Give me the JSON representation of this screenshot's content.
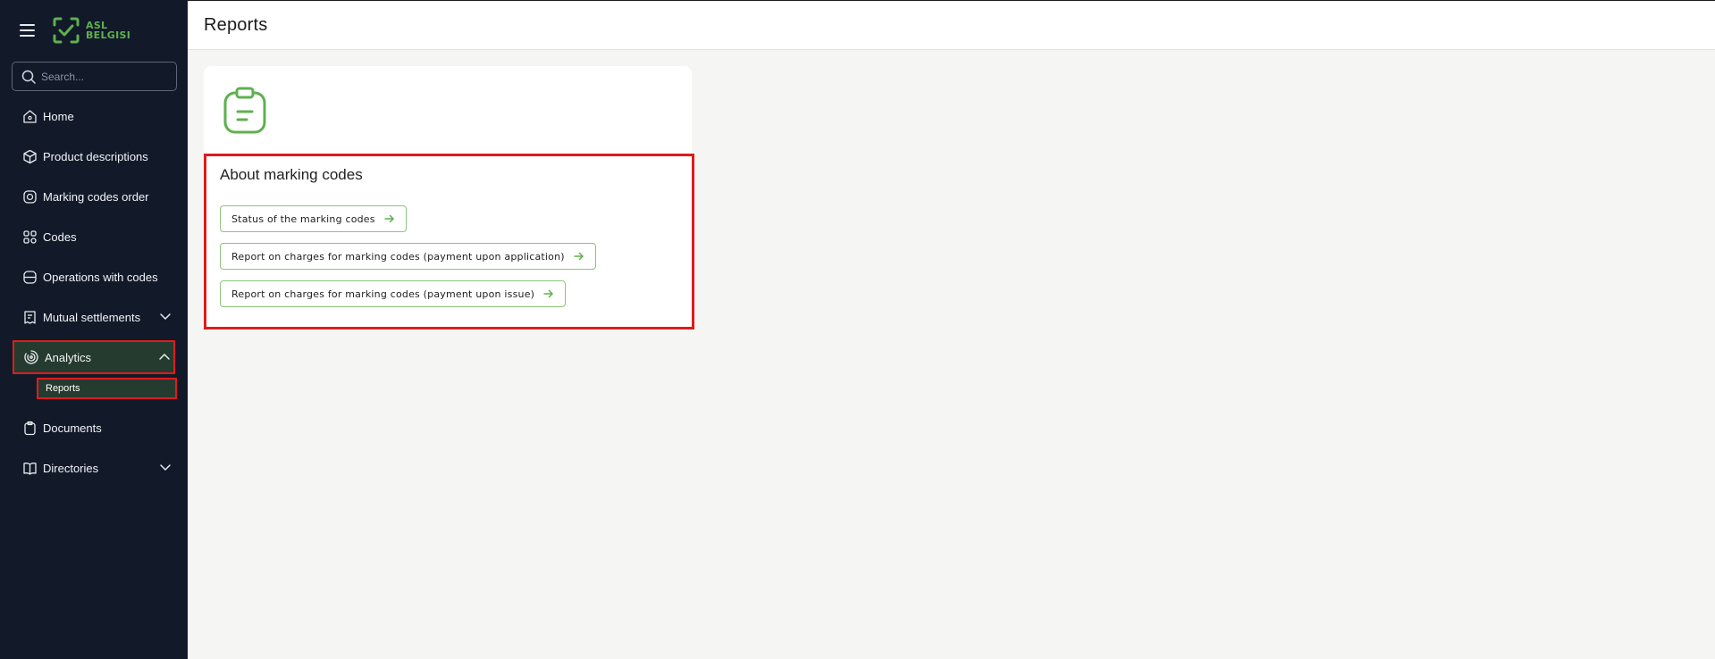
{
  "brand": {
    "logo_line1": "ASL",
    "logo_line2": "BELGISI",
    "accent_color": "#5fb04f"
  },
  "search": {
    "placeholder": "Search..."
  },
  "sidebar": {
    "items": [
      {
        "label": "Home",
        "icon": "home-icon"
      },
      {
        "label": "Product descriptions",
        "icon": "box-icon"
      },
      {
        "label": "Marking codes order",
        "icon": "code-order-icon"
      },
      {
        "label": "Codes",
        "icon": "qr-codes-icon"
      },
      {
        "label": "Operations with codes",
        "icon": "operations-icon"
      },
      {
        "label": "Mutual settlements",
        "icon": "receipt-icon",
        "expandable": true
      },
      {
        "label": "Analytics",
        "icon": "analytics-icon",
        "expanded": true,
        "active": true
      },
      {
        "label": "Documents",
        "icon": "clipboard-icon"
      },
      {
        "label": "Directories",
        "icon": "book-icon",
        "expandable": true
      }
    ],
    "analytics_sub": [
      {
        "label": "Reports",
        "active": true
      }
    ]
  },
  "header": {
    "title": "Reports"
  },
  "card": {
    "icon": "clipboard-icon",
    "section_title": "About marking codes",
    "links": [
      {
        "label": "Status of the marking codes"
      },
      {
        "label": "Report on charges for marking codes (payment upon application)"
      },
      {
        "label": "Report on charges for marking codes (payment upon issue)"
      }
    ]
  }
}
